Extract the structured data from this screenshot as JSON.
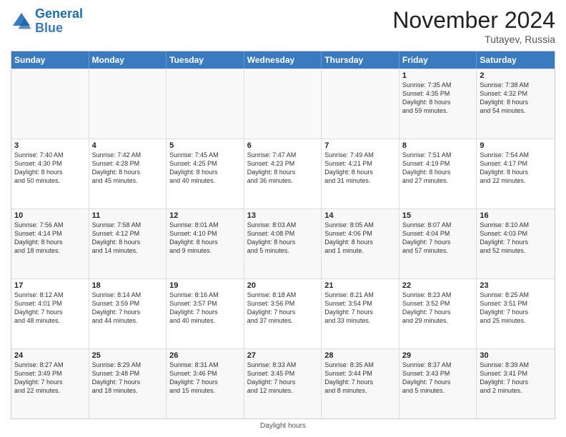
{
  "header": {
    "logo_line1": "General",
    "logo_line2": "Blue",
    "month": "November 2024",
    "location": "Tutayev, Russia"
  },
  "days_of_week": [
    "Sunday",
    "Monday",
    "Tuesday",
    "Wednesday",
    "Thursday",
    "Friday",
    "Saturday"
  ],
  "footer": "Daylight hours",
  "weeks": [
    [
      {
        "day": "",
        "detail": "",
        "empty": true
      },
      {
        "day": "",
        "detail": "",
        "empty": true
      },
      {
        "day": "",
        "detail": "",
        "empty": true
      },
      {
        "day": "",
        "detail": "",
        "empty": true
      },
      {
        "day": "",
        "detail": "",
        "empty": true
      },
      {
        "day": "1",
        "detail": "Sunrise: 7:35 AM\nSunset: 4:35 PM\nDaylight: 8 hours\nand 59 minutes.",
        "empty": false
      },
      {
        "day": "2",
        "detail": "Sunrise: 7:38 AM\nSunset: 4:32 PM\nDaylight: 8 hours\nand 54 minutes.",
        "empty": false
      }
    ],
    [
      {
        "day": "3",
        "detail": "Sunrise: 7:40 AM\nSunset: 4:30 PM\nDaylight: 8 hours\nand 50 minutes.",
        "empty": false
      },
      {
        "day": "4",
        "detail": "Sunrise: 7:42 AM\nSunset: 4:28 PM\nDaylight: 8 hours\nand 45 minutes.",
        "empty": false
      },
      {
        "day": "5",
        "detail": "Sunrise: 7:45 AM\nSunset: 4:25 PM\nDaylight: 8 hours\nand 40 minutes.",
        "empty": false
      },
      {
        "day": "6",
        "detail": "Sunrise: 7:47 AM\nSunset: 4:23 PM\nDaylight: 8 hours\nand 36 minutes.",
        "empty": false
      },
      {
        "day": "7",
        "detail": "Sunrise: 7:49 AM\nSunset: 4:21 PM\nDaylight: 8 hours\nand 31 minutes.",
        "empty": false
      },
      {
        "day": "8",
        "detail": "Sunrise: 7:51 AM\nSunset: 4:19 PM\nDaylight: 8 hours\nand 27 minutes.",
        "empty": false
      },
      {
        "day": "9",
        "detail": "Sunrise: 7:54 AM\nSunset: 4:17 PM\nDaylight: 8 hours\nand 22 minutes.",
        "empty": false
      }
    ],
    [
      {
        "day": "10",
        "detail": "Sunrise: 7:56 AM\nSunset: 4:14 PM\nDaylight: 8 hours\nand 18 minutes.",
        "empty": false
      },
      {
        "day": "11",
        "detail": "Sunrise: 7:58 AM\nSunset: 4:12 PM\nDaylight: 8 hours\nand 14 minutes.",
        "empty": false
      },
      {
        "day": "12",
        "detail": "Sunrise: 8:01 AM\nSunset: 4:10 PM\nDaylight: 8 hours\nand 9 minutes.",
        "empty": false
      },
      {
        "day": "13",
        "detail": "Sunrise: 8:03 AM\nSunset: 4:08 PM\nDaylight: 8 hours\nand 5 minutes.",
        "empty": false
      },
      {
        "day": "14",
        "detail": "Sunrise: 8:05 AM\nSunset: 4:06 PM\nDaylight: 8 hours\nand 1 minute.",
        "empty": false
      },
      {
        "day": "15",
        "detail": "Sunrise: 8:07 AM\nSunset: 4:04 PM\nDaylight: 7 hours\nand 57 minutes.",
        "empty": false
      },
      {
        "day": "16",
        "detail": "Sunrise: 8:10 AM\nSunset: 4:03 PM\nDaylight: 7 hours\nand 52 minutes.",
        "empty": false
      }
    ],
    [
      {
        "day": "17",
        "detail": "Sunrise: 8:12 AM\nSunset: 4:01 PM\nDaylight: 7 hours\nand 48 minutes.",
        "empty": false
      },
      {
        "day": "18",
        "detail": "Sunrise: 8:14 AM\nSunset: 3:59 PM\nDaylight: 7 hours\nand 44 minutes.",
        "empty": false
      },
      {
        "day": "19",
        "detail": "Sunrise: 8:16 AM\nSunset: 3:57 PM\nDaylight: 7 hours\nand 40 minutes.",
        "empty": false
      },
      {
        "day": "20",
        "detail": "Sunrise: 8:18 AM\nSunset: 3:56 PM\nDaylight: 7 hours\nand 37 minutes.",
        "empty": false
      },
      {
        "day": "21",
        "detail": "Sunrise: 8:21 AM\nSunset: 3:54 PM\nDaylight: 7 hours\nand 33 minutes.",
        "empty": false
      },
      {
        "day": "22",
        "detail": "Sunrise: 8:23 AM\nSunset: 3:52 PM\nDaylight: 7 hours\nand 29 minutes.",
        "empty": false
      },
      {
        "day": "23",
        "detail": "Sunrise: 8:25 AM\nSunset: 3:51 PM\nDaylight: 7 hours\nand 25 minutes.",
        "empty": false
      }
    ],
    [
      {
        "day": "24",
        "detail": "Sunrise: 8:27 AM\nSunset: 3:49 PM\nDaylight: 7 hours\nand 22 minutes.",
        "empty": false
      },
      {
        "day": "25",
        "detail": "Sunrise: 8:29 AM\nSunset: 3:48 PM\nDaylight: 7 hours\nand 18 minutes.",
        "empty": false
      },
      {
        "day": "26",
        "detail": "Sunrise: 8:31 AM\nSunset: 3:46 PM\nDaylight: 7 hours\nand 15 minutes.",
        "empty": false
      },
      {
        "day": "27",
        "detail": "Sunrise: 8:33 AM\nSunset: 3:45 PM\nDaylight: 7 hours\nand 12 minutes.",
        "empty": false
      },
      {
        "day": "28",
        "detail": "Sunrise: 8:35 AM\nSunset: 3:44 PM\nDaylight: 7 hours\nand 8 minutes.",
        "empty": false
      },
      {
        "day": "29",
        "detail": "Sunrise: 8:37 AM\nSunset: 3:43 PM\nDaylight: 7 hours\nand 5 minutes.",
        "empty": false
      },
      {
        "day": "30",
        "detail": "Sunrise: 8:39 AM\nSunset: 3:41 PM\nDaylight: 7 hours\nand 2 minutes.",
        "empty": false
      }
    ]
  ]
}
